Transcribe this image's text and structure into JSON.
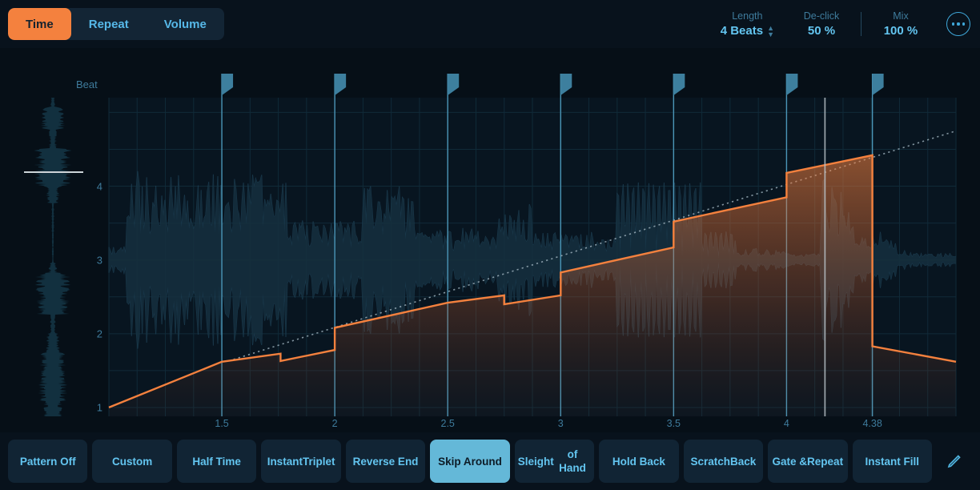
{
  "header": {
    "tabs": [
      {
        "label": "Time",
        "active": true
      },
      {
        "label": "Repeat",
        "active": false
      },
      {
        "label": "Volume",
        "active": false
      }
    ],
    "params": [
      {
        "label": "Length",
        "value": "4 Beats",
        "stepper": true
      },
      {
        "label": "De-click",
        "value": "50 %",
        "stepper": false
      },
      {
        "label": "Mix",
        "value": "100 %",
        "stepper": false
      }
    ],
    "more_icon": "ellipsis-circle-icon"
  },
  "plot": {
    "y_axis_title": "Beat",
    "accent_color": "#f4813e",
    "marker_color": "#3d7f9e",
    "playhead_color": "#b9c3c9",
    "grid_color": "#13303f"
  },
  "bottom": {
    "buttons": [
      {
        "label": "Pattern Off",
        "active": false
      },
      {
        "label": "Custom",
        "active": false
      },
      {
        "label": "Half Time",
        "active": false
      },
      {
        "label": "Instant\nTriplet",
        "active": false
      },
      {
        "label": "Reverse End",
        "active": false
      },
      {
        "label": "Skip Around",
        "active": true
      },
      {
        "label": "Sleight\nof Hand",
        "active": false
      },
      {
        "label": "Hold Back",
        "active": false
      },
      {
        "label": "Scratch\nBack",
        "active": false
      },
      {
        "label": "Gate &\nRepeat",
        "active": false
      },
      {
        "label": "Instant Fill",
        "active": false
      }
    ],
    "edit_icon": "pencil-icon"
  },
  "chart_data": {
    "type": "line",
    "title": "",
    "xlabel": "",
    "ylabel": "Beat",
    "xlim": [
      1.0,
      4.75
    ],
    "ylim": [
      0.88,
      5.2
    ],
    "x_ticks": [
      1.5,
      2,
      2.5,
      3,
      3.5,
      4,
      4.38
    ],
    "x_tick_labels": [
      "1.5",
      "2",
      "2.5",
      "3",
      "3.5",
      "4",
      "4.38"
    ],
    "y_ticks": [
      1,
      2,
      3,
      4
    ],
    "y_tick_labels": [
      "1",
      "2",
      "3",
      "4"
    ],
    "grid": true,
    "legend": "none",
    "playhead_x": 4.17,
    "markers_x": [
      1.5,
      2.0,
      2.5,
      3.0,
      3.5,
      4.0,
      4.38
    ],
    "series": [
      {
        "name": "Reference Ramp (dotted)",
        "style": "dotted",
        "color": "#9fb2bd",
        "points": [
          [
            1.53,
            1.63
          ],
          [
            4.75,
            4.75
          ]
        ]
      },
      {
        "name": "Time Mapping (orange)",
        "style": "solid-filled",
        "color": "#f4813e",
        "points": [
          [
            1.0,
            1.0
          ],
          [
            1.5,
            1.62
          ],
          [
            1.76,
            1.73
          ],
          [
            1.76,
            1.63
          ],
          [
            2.0,
            1.78
          ],
          [
            2.0,
            2.08
          ],
          [
            2.5,
            2.42
          ],
          [
            2.75,
            2.52
          ],
          [
            2.75,
            2.4
          ],
          [
            3.0,
            2.52
          ],
          [
            3.0,
            2.83
          ],
          [
            3.5,
            3.17
          ],
          [
            3.5,
            3.52
          ],
          [
            4.0,
            3.85
          ],
          [
            4.0,
            4.18
          ],
          [
            4.38,
            4.42
          ],
          [
            4.38,
            1.83
          ],
          [
            4.75,
            1.62
          ]
        ]
      }
    ]
  }
}
